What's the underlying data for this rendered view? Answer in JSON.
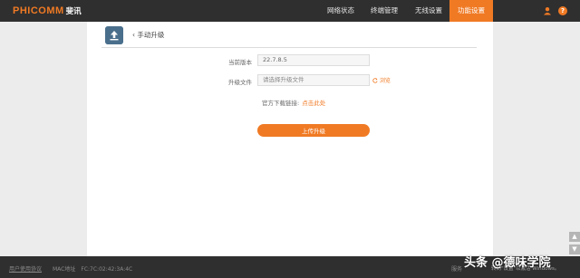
{
  "header": {
    "logo_text": "PHICOMM",
    "logo_cn": "斐讯",
    "nav": [
      "网络状态",
      "终端管理",
      "无线设置",
      "功能设置"
    ],
    "active_nav": "功能设置",
    "accent": "#f07a24"
  },
  "page": {
    "title": "手动升级",
    "icon": "upload-icon"
  },
  "form": {
    "current_version_label": "当前版本",
    "current_version_value": "22.7.8.5",
    "upgrade_file_label": "升级文件",
    "file_placeholder": "请选择升级文件",
    "browse_label": "浏览",
    "official_download_label": "官方下载链接:",
    "official_download_link": "点击此处",
    "upload_button": "上传升级"
  },
  "footer": {
    "agreement_link": "用户使用协议",
    "mac_label": "MAC地址",
    "mac_value": "FC:7C:02:42:3A:4C",
    "right_text": "服务",
    "activate_text": "转到\"设置\"以激活 Windows。"
  },
  "watermark": "头条 @德味学院"
}
